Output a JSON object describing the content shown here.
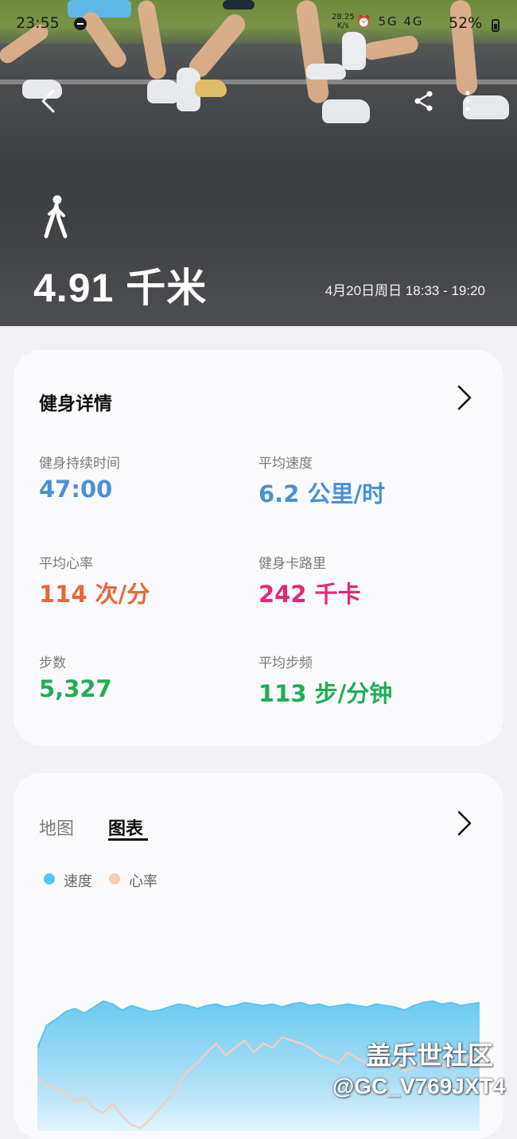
{
  "status_bar": {
    "time": "23:55",
    "net_speed_value": "28.25",
    "net_speed_unit": "K/s",
    "network_icons": "⏰ 5G 4G",
    "battery": "52%"
  },
  "hero": {
    "activity_icon": "walking-icon",
    "distance": "4.91 千米",
    "date_range": "4月20日周日 18:33 - 19:20"
  },
  "fitness_card": {
    "title": "健身详情",
    "metrics": [
      {
        "label": "健身持续时间",
        "value": "47:00",
        "color": "#4a90d9"
      },
      {
        "label": "平均速度",
        "value": "6.2 公里/时",
        "color": "#4a90d9"
      },
      {
        "label": "平均心率",
        "value": "114 次/分",
        "color": "#e8663a"
      },
      {
        "label": "健身卡路里",
        "value": "242 千卡",
        "color": "#e0297a"
      },
      {
        "label": "步数",
        "value": "5,327",
        "color": "#1fae55"
      },
      {
        "label": "平均步频",
        "value": "113 步/分钟",
        "color": "#1fae55"
      }
    ]
  },
  "chart_card": {
    "tabs": [
      "地图",
      "图表"
    ],
    "active_tab": "图表",
    "legend": [
      {
        "label": "速度",
        "color": "#5cc3ee"
      },
      {
        "label": "心率",
        "color": "#f6cdb6"
      }
    ]
  },
  "chart_data": {
    "type": "area",
    "series": [
      {
        "name": "速度",
        "color": "#5cc3ee",
        "values": [
          0.55,
          0.7,
          0.74,
          0.79,
          0.81,
          0.78,
          0.82,
          0.86,
          0.84,
          0.8,
          0.83,
          0.81,
          0.79,
          0.8,
          0.82,
          0.84,
          0.83,
          0.81,
          0.83,
          0.84,
          0.82,
          0.83,
          0.85,
          0.84,
          0.83,
          0.84,
          0.82,
          0.84,
          0.85,
          0.83,
          0.84,
          0.82,
          0.83,
          0.84,
          0.83,
          0.82,
          0.84,
          0.83,
          0.82,
          0.8,
          0.83,
          0.85,
          0.86,
          0.84,
          0.85,
          0.83,
          0.84,
          0.85
        ]
      },
      {
        "name": "心率",
        "color": "#f6cdb6",
        "values": [
          0.35,
          0.3,
          0.28,
          0.26,
          0.2,
          0.22,
          0.15,
          0.12,
          0.18,
          0.1,
          0.04,
          0.02,
          0.08,
          0.15,
          0.22,
          0.3,
          0.4,
          0.45,
          0.52,
          0.58,
          0.5,
          0.55,
          0.6,
          0.52,
          0.58,
          0.55,
          0.62,
          0.6,
          0.58,
          0.55,
          0.5,
          0.48,
          0.45,
          0.52,
          0.48,
          0.45,
          0.42,
          0.46,
          0.44,
          0.4,
          0.42,
          0.46,
          0.48,
          0.44,
          0.42,
          0.46,
          0.5,
          0.48
        ]
      }
    ]
  },
  "watermark": {
    "line1": "盖乐世社区",
    "line2": "@GC_V769JXT4"
  }
}
